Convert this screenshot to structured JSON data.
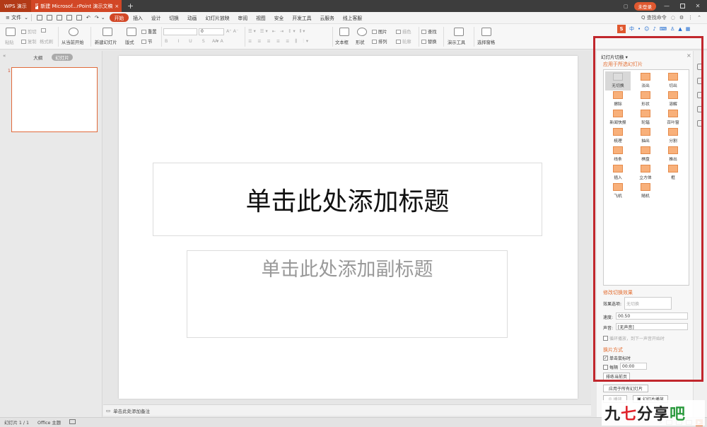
{
  "titlebar": {
    "app_tab": "WPS 演示",
    "doc_tab": "新建 Microsof...rPoint 演示文稿",
    "login": "未登录"
  },
  "menubar": {
    "file": "≡ 文件",
    "tabs": [
      "开始",
      "插入",
      "设计",
      "切换",
      "动画",
      "幻灯片放映",
      "审阅",
      "视图",
      "安全",
      "开发工具",
      "云服务",
      "线上客服"
    ],
    "search": "Q 查找命令"
  },
  "ribbon": {
    "paste": "粘贴",
    "cut": "剪切",
    "copy": "复制",
    "format_painter": "格式刷",
    "play_from_current": "从当前开始",
    "new_slide": "新建幻灯片",
    "layout": "版式",
    "reset": "重置",
    "section": "节",
    "font_size": "0",
    "text_box": "文本框",
    "shape": "形状",
    "picture": "图片",
    "arrange": "排列",
    "replace_dim": "替换",
    "find": "查找",
    "replace": "替换",
    "presentation_tools": "演示工具",
    "select_pane": "选择窗格",
    "style_dim": "描色",
    "outline_dim": "轮廓"
  },
  "leftpane": {
    "tab_outline": "大纲",
    "tab_slides": "幻灯片",
    "slide_number": "1"
  },
  "slide": {
    "title_placeholder": "单击此处添加标题",
    "subtitle_placeholder": "单击此处添加副标题"
  },
  "notes": {
    "placeholder": "单击此处添加备注"
  },
  "taskpane": {
    "header": "幻灯片切换 ▾",
    "section_apply": "应用于所选幻灯片",
    "transitions": [
      "无切换",
      "淡出",
      "切出",
      "擦除",
      "形状",
      "溶解",
      "新闻快报",
      "轮辐",
      "百叶窗",
      "梳理",
      "抽出",
      "分割",
      "线条",
      "棋盘",
      "推出",
      "插入",
      "立方体",
      "框",
      "飞机",
      "随机"
    ],
    "section_modify": "修改切换效果",
    "effect_label": "效果选项:",
    "effect_value": "无切换",
    "speed_label": "速度:",
    "speed_value": "00.50",
    "sound_label": "声音:",
    "sound_value": "[无声音]",
    "loop_label": "循环播放，到下一声音开始时",
    "section_advance": "换片方式",
    "on_click": "单击鼠标时",
    "every": "每隔",
    "every_value": "00:00",
    "sort_current": "排练当前页",
    "apply_all": "应用于所有幻灯片",
    "play": "播放",
    "slideshow": "幻灯片播放"
  },
  "statusbar": {
    "slide_info": "幻灯片 1 / 1",
    "theme": "Office 主题"
  },
  "watermark": {
    "a": "九",
    "b": "七",
    "c": "分享",
    "d": "吧"
  }
}
